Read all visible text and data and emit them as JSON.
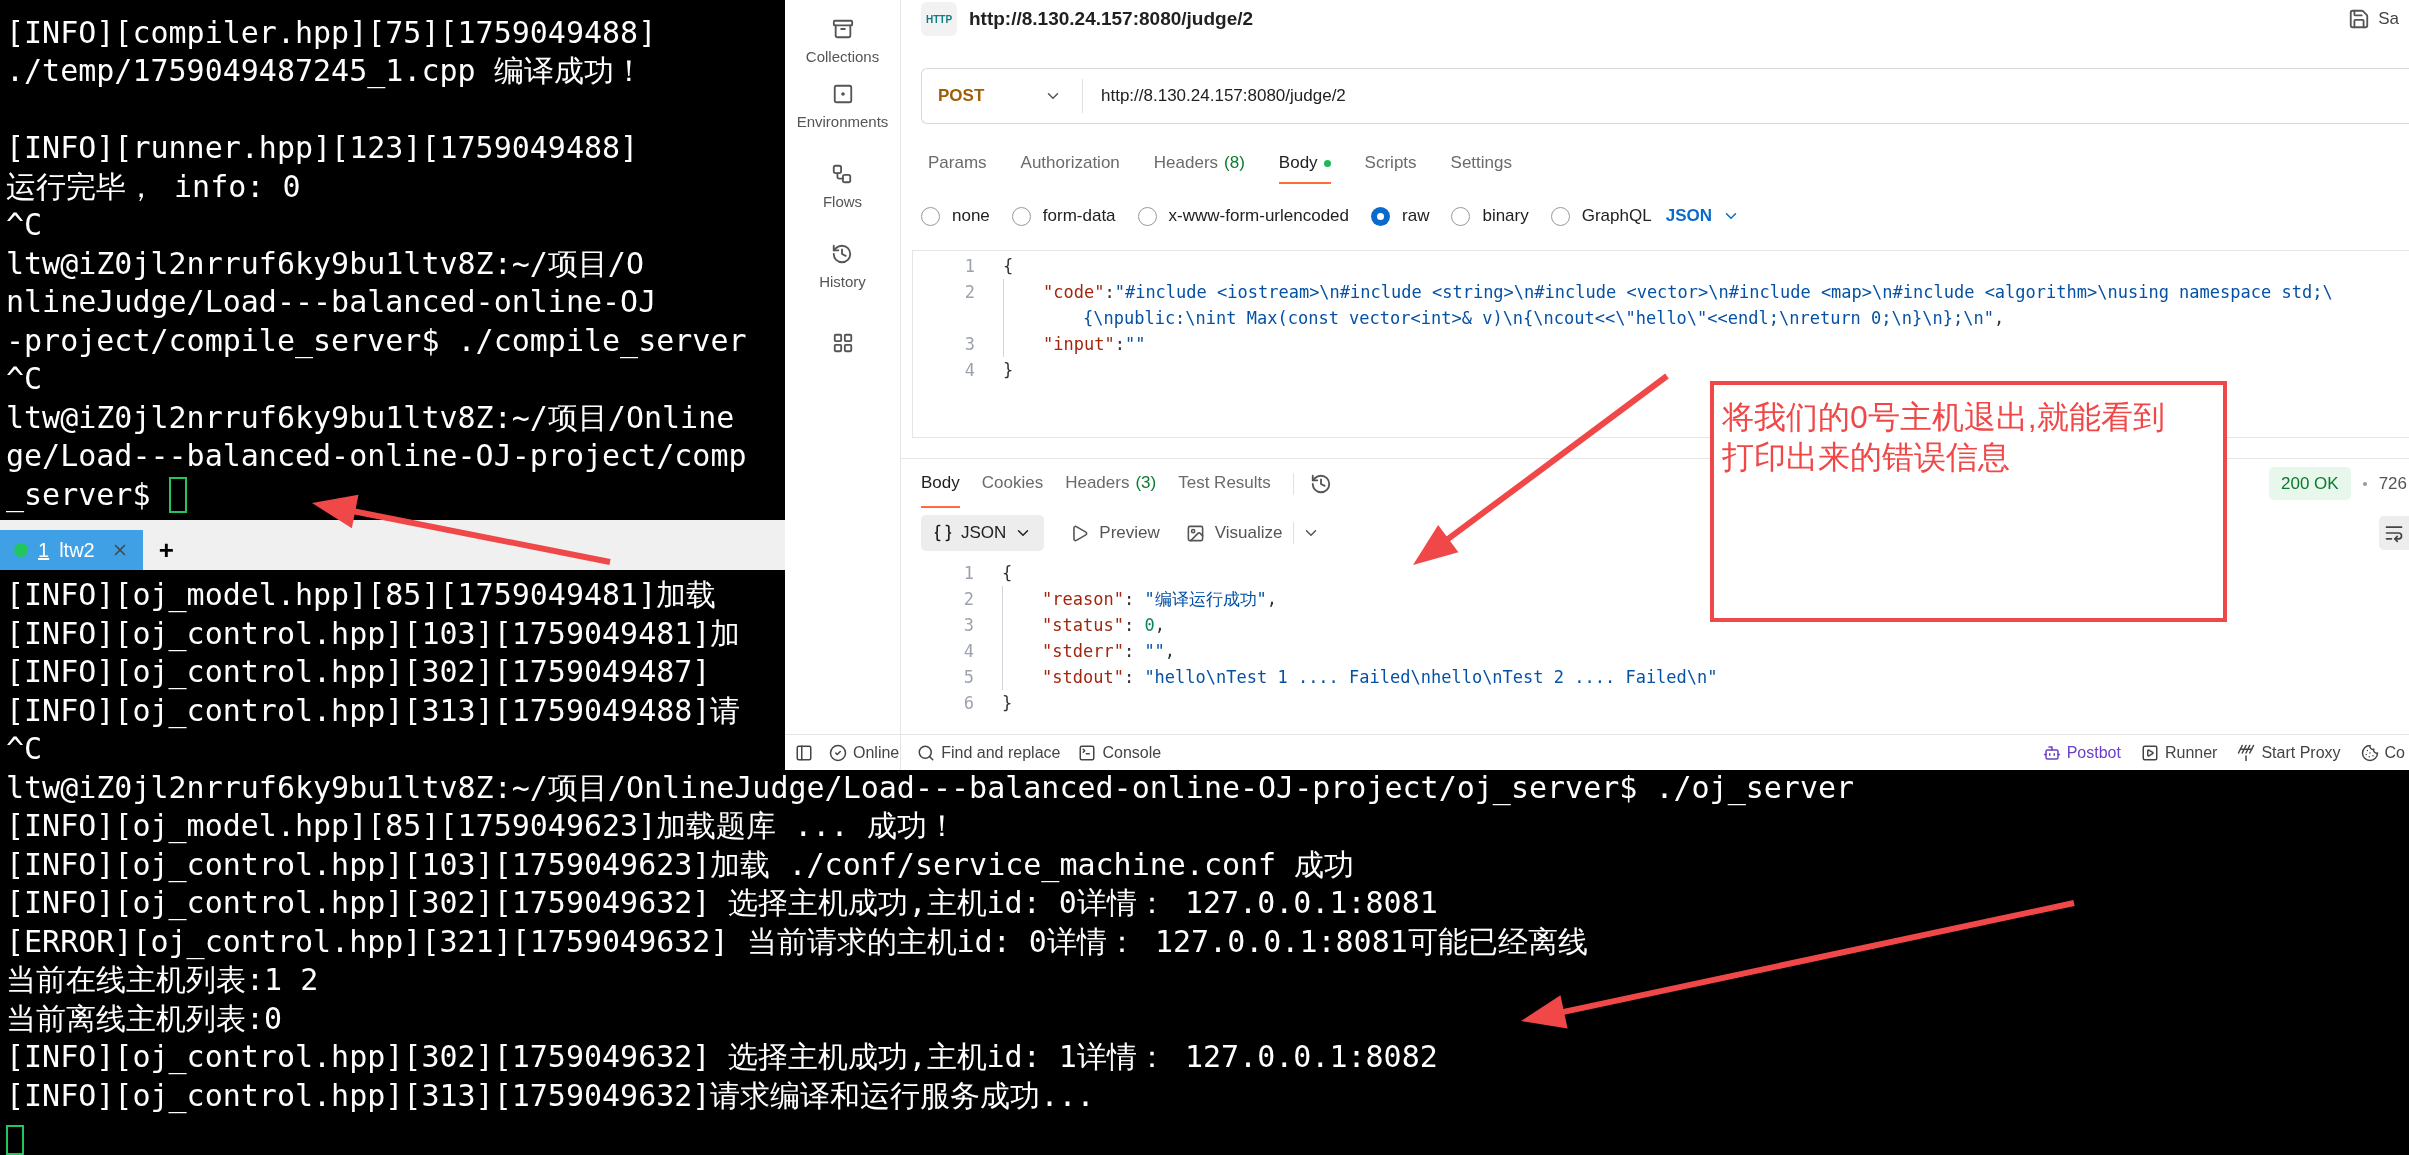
{
  "top_terminal": {
    "blocks": [
      [
        "[INFO][compiler.hpp][75][1759049488]",
        "./temp/1759049487245_1.cpp 编译成功！"
      ],
      [
        "[INFO][runner.hpp][123][1759049488]",
        "运行完毕， info: 0",
        "^C",
        "ltw@iZ0jl2nrruf6ky9bu1ltv8Z:~/项目/O",
        "nlineJudge/Load---balanced-online-OJ",
        "-project/compile_server$ ./compile_server",
        "^C",
        "ltw@iZ0jl2nrruf6ky9bu1ltv8Z:~/项目/Online",
        "ge/Load---balanced-online-OJ-project/comp",
        "_server$"
      ]
    ]
  },
  "tab_bar": {
    "tabs": [
      {
        "index": "1",
        "label": "ltw2",
        "selected": true,
        "color": "#22c55e"
      }
    ],
    "add": "+"
  },
  "bottom_terminal": {
    "lines": [
      "[INFO][oj_model.hpp][85][1759049481]加载",
      "[INFO][oj_control.hpp][103][1759049481]加",
      "[INFO][oj_control.hpp][302][1759049487]",
      "[INFO][oj_control.hpp][313][1759049488]请",
      "^C",
      "ltw@iZ0jl2nrruf6ky9bu1ltv8Z:~/项目/OnlineJudge/Load---balanced-online-OJ-project/oj_server$ ./oj_server",
      "[INFO][oj_model.hpp][85][1759049623]加载题库 ... 成功！",
      "[INFO][oj_control.hpp][103][1759049623]加载 ./conf/service_machine.conf 成功",
      "[INFO][oj_control.hpp][302][1759049632] 选择主机成功,主机id: 0详情： 127.0.0.1:8081",
      "[ERROR][oj_control.hpp][321][1759049632] 当前请求的主机id: 0详情： 127.0.0.1:8081可能已经离线",
      "当前在线主机列表:1 2",
      "当前离线主机列表:0",
      "[INFO][oj_control.hpp][302][1759049632] 选择主机成功,主机id: 1详情： 127.0.0.1:8082",
      "[INFO][oj_control.hpp][313][1759049632]请求编译和运行服务成功..."
    ]
  },
  "postman": {
    "sidebar": {
      "items": [
        {
          "label": "Collections"
        },
        {
          "label": "Environments"
        },
        {
          "label": "Flows"
        },
        {
          "label": "History"
        }
      ]
    },
    "request": {
      "icon_text": "HTTP",
      "title": "http://8.130.24.157:8080/judge/2",
      "save": "Sa",
      "method": "POST",
      "url": "http://8.130.24.157:8080/judge/2"
    },
    "request_tabs": [
      {
        "label": "Params",
        "selected": false,
        "dot": false
      },
      {
        "label": "Authorization",
        "selected": false,
        "dot": false
      },
      {
        "label": "Headers",
        "count": "(8)",
        "selected": false,
        "dot": false
      },
      {
        "label": "Body",
        "selected": true,
        "dot": true
      },
      {
        "label": "Scripts",
        "selected": false,
        "dot": false
      },
      {
        "label": "Settings",
        "selected": false,
        "dot": false
      }
    ],
    "body_types": {
      "options": [
        {
          "label": "none",
          "selected": false
        },
        {
          "label": "form-data",
          "selected": false
        },
        {
          "label": "x-www-form-urlencoded",
          "selected": false
        },
        {
          "label": "raw",
          "selected": true
        },
        {
          "label": "binary",
          "selected": false
        },
        {
          "label": "GraphQL",
          "selected": false
        }
      ],
      "format": "JSON"
    },
    "body_editor": {
      "lines": [
        {
          "num": "1",
          "indented": false,
          "rows": [
            {
              "parts": [
                {
                  "kind": "punct",
                  "text": "{"
                }
              ]
            }
          ]
        },
        {
          "num": "2",
          "indented": true,
          "rows": [
            {
              "parts": [
                {
                  "kind": "key",
                  "text": "\"code\""
                },
                {
                  "kind": "punct",
                  "text": ":"
                },
                {
                  "kind": "string",
                  "text": "\"#include <iostream>\\n#include <string>\\n#include <vector>\\n#include <map>\\n#include <algorithm>\\nusing namespace std;\\"
                }
              ]
            },
            {
              "parts": [
                {
                  "kind": "string",
                  "text": "{\\npublic:\\nint Max(const vector<int>& v)\\n{\\ncout<<\\\"hello\\\"<<endl;\\nreturn 0;\\n}\\n};\\n\""
                },
                {
                  "kind": "punct",
                  "text": ","
                }
              ]
            }
          ]
        },
        {
          "num": "3",
          "indented": true,
          "rows": [
            {
              "parts": [
                {
                  "kind": "key",
                  "text": "\"input\""
                },
                {
                  "kind": "punct",
                  "text": ":"
                },
                {
                  "kind": "string",
                  "text": "\"\""
                }
              ]
            }
          ]
        },
        {
          "num": "4",
          "indented": false,
          "rows": [
            {
              "parts": [
                {
                  "kind": "punct",
                  "text": "}"
                }
              ]
            }
          ]
        }
      ]
    },
    "response": {
      "tabs": [
        {
          "label": "Body",
          "selected": true
        },
        {
          "label": "Cookies",
          "selected": false
        },
        {
          "label": "Headers",
          "count": "(3)",
          "selected": false
        },
        {
          "label": "Test Results",
          "selected": false
        }
      ],
      "status": "200 OK",
      "size": "726",
      "view": "JSON",
      "actions": [
        "Preview",
        "Visualize"
      ],
      "lines": [
        {
          "num": "1",
          "indented": false,
          "rows": [
            {
              "parts": [
                {
                  "kind": "punct",
                  "text": "{"
                }
              ]
            }
          ]
        },
        {
          "num": "2",
          "indented": true,
          "rows": [
            {
              "parts": [
                {
                  "kind": "key",
                  "text": "\"reason\""
                },
                {
                  "kind": "punct",
                  "text": ": "
                },
                {
                  "kind": "string",
                  "text": "\"编译运行成功\""
                },
                {
                  "kind": "punct",
                  "text": ","
                }
              ]
            }
          ]
        },
        {
          "num": "3",
          "indented": true,
          "rows": [
            {
              "parts": [
                {
                  "kind": "key",
                  "text": "\"status\""
                },
                {
                  "kind": "punct",
                  "text": ": "
                },
                {
                  "kind": "number",
                  "text": "0"
                },
                {
                  "kind": "punct",
                  "text": ","
                }
              ]
            }
          ]
        },
        {
          "num": "4",
          "indented": true,
          "rows": [
            {
              "parts": [
                {
                  "kind": "key",
                  "text": "\"stderr\""
                },
                {
                  "kind": "punct",
                  "text": ": "
                },
                {
                  "kind": "string",
                  "text": "\"\""
                },
                {
                  "kind": "punct",
                  "text": ","
                }
              ]
            }
          ]
        },
        {
          "num": "5",
          "indented": true,
          "rows": [
            {
              "parts": [
                {
                  "kind": "key",
                  "text": "\"stdout\""
                },
                {
                  "kind": "punct",
                  "text": ": "
                },
                {
                  "kind": "string",
                  "text": "\"hello\\nTest 1 .... Failed\\nhello\\nTest 2 .... Failed\\n\""
                }
              ]
            }
          ]
        },
        {
          "num": "6",
          "indented": false,
          "rows": [
            {
              "parts": [
                {
                  "kind": "punct",
                  "text": "}"
                }
              ]
            }
          ]
        }
      ]
    },
    "status_bar": {
      "left": [
        "Online",
        "Find and replace",
        "Console"
      ],
      "right": [
        "Postbot",
        "Runner",
        "Start Proxy",
        "Co"
      ]
    }
  },
  "annotation": {
    "text": "将我们的0号主机退出,就能看到打印出来的错误信息"
  }
}
